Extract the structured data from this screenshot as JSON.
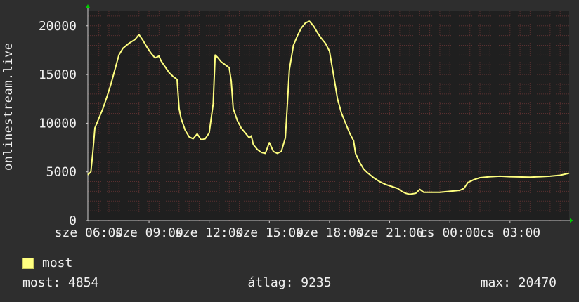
{
  "colors": {
    "background": "#2e2e2e",
    "plot_background": "#1f1f1f",
    "grid": "#5a3030",
    "series": "#ffff80",
    "axis": "#cfcfcf",
    "arrow": "#00cc00"
  },
  "chart_data": {
    "type": "line",
    "ylabel": "onlinestream.live",
    "ylim": [
      0,
      21500
    ],
    "yticks": [
      0,
      5000,
      10000,
      15000,
      20000
    ],
    "xticks": [
      {
        "t": 6,
        "label": "sze 06:00"
      },
      {
        "t": 9,
        "label": "sze 09:00"
      },
      {
        "t": 12,
        "label": "sze 12:00"
      },
      {
        "t": 15,
        "label": "sze 15:00"
      },
      {
        "t": 18,
        "label": "sze 18:00"
      },
      {
        "t": 21,
        "label": "sze 21:00"
      },
      {
        "t": 24,
        "label": "cs 00:00"
      },
      {
        "t": 27,
        "label": "cs 03:00"
      }
    ],
    "xlim": [
      5.95,
      29.95
    ],
    "grid": true,
    "series": [
      {
        "name": "most",
        "points": [
          [
            5.95,
            4700
          ],
          [
            6.1,
            5000
          ],
          [
            6.2,
            7000
          ],
          [
            6.3,
            9500
          ],
          [
            6.5,
            10500
          ],
          [
            6.7,
            11500
          ],
          [
            6.9,
            12700
          ],
          [
            7.1,
            14000
          ],
          [
            7.3,
            15500
          ],
          [
            7.5,
            17000
          ],
          [
            7.7,
            17700
          ],
          [
            8.0,
            18200
          ],
          [
            8.3,
            18600
          ],
          [
            8.5,
            19100
          ],
          [
            8.7,
            18500
          ],
          [
            8.9,
            17800
          ],
          [
            9.1,
            17200
          ],
          [
            9.3,
            16700
          ],
          [
            9.5,
            16900
          ],
          [
            9.6,
            16400
          ],
          [
            9.8,
            15800
          ],
          [
            10.0,
            15200
          ],
          [
            10.2,
            14800
          ],
          [
            10.4,
            14500
          ],
          [
            10.5,
            11500
          ],
          [
            10.6,
            10500
          ],
          [
            10.8,
            9300
          ],
          [
            11.0,
            8600
          ],
          [
            11.2,
            8400
          ],
          [
            11.4,
            8900
          ],
          [
            11.6,
            8300
          ],
          [
            11.8,
            8400
          ],
          [
            12.0,
            9000
          ],
          [
            12.2,
            12000
          ],
          [
            12.3,
            17000
          ],
          [
            12.4,
            16800
          ],
          [
            12.6,
            16300
          ],
          [
            12.8,
            16000
          ],
          [
            13.0,
            15700
          ],
          [
            13.1,
            14300
          ],
          [
            13.2,
            11500
          ],
          [
            13.4,
            10300
          ],
          [
            13.6,
            9500
          ],
          [
            13.8,
            9000
          ],
          [
            14.0,
            8500
          ],
          [
            14.1,
            8700
          ],
          [
            14.2,
            7800
          ],
          [
            14.4,
            7300
          ],
          [
            14.6,
            7000
          ],
          [
            14.8,
            6900
          ],
          [
            15.0,
            8000
          ],
          [
            15.2,
            7100
          ],
          [
            15.4,
            6900
          ],
          [
            15.6,
            7100
          ],
          [
            15.8,
            8500
          ],
          [
            15.9,
            12000
          ],
          [
            16.0,
            15500
          ],
          [
            16.2,
            18000
          ],
          [
            16.4,
            19000
          ],
          [
            16.6,
            19800
          ],
          [
            16.8,
            20300
          ],
          [
            17.0,
            20470
          ],
          [
            17.2,
            20000
          ],
          [
            17.4,
            19300
          ],
          [
            17.6,
            18700
          ],
          [
            17.8,
            18200
          ],
          [
            18.0,
            17400
          ],
          [
            18.2,
            15000
          ],
          [
            18.4,
            12500
          ],
          [
            18.6,
            11000
          ],
          [
            18.8,
            10000
          ],
          [
            19.0,
            9000
          ],
          [
            19.2,
            8200
          ],
          [
            19.3,
            6900
          ],
          [
            19.5,
            6000
          ],
          [
            19.7,
            5300
          ],
          [
            19.9,
            4900
          ],
          [
            20.2,
            4400
          ],
          [
            20.5,
            4000
          ],
          [
            20.8,
            3700
          ],
          [
            21.1,
            3500
          ],
          [
            21.4,
            3300
          ],
          [
            21.6,
            3000
          ],
          [
            21.8,
            2800
          ],
          [
            22.0,
            2700
          ],
          [
            22.3,
            2800
          ],
          [
            22.5,
            3200
          ],
          [
            22.7,
            2900
          ],
          [
            23.0,
            2900
          ],
          [
            23.5,
            2900
          ],
          [
            24.0,
            3000
          ],
          [
            24.5,
            3100
          ],
          [
            24.7,
            3300
          ],
          [
            24.9,
            3900
          ],
          [
            25.2,
            4200
          ],
          [
            25.5,
            4400
          ],
          [
            26.0,
            4500
          ],
          [
            26.5,
            4550
          ],
          [
            27.0,
            4500
          ],
          [
            28.0,
            4450
          ],
          [
            28.5,
            4500
          ],
          [
            29.0,
            4550
          ],
          [
            29.5,
            4650
          ],
          [
            29.95,
            4854
          ]
        ]
      }
    ]
  },
  "legend": {
    "label": "most"
  },
  "stats": {
    "current": "most: 4854",
    "average": "átlag: 9235",
    "max": "max: 20470"
  }
}
